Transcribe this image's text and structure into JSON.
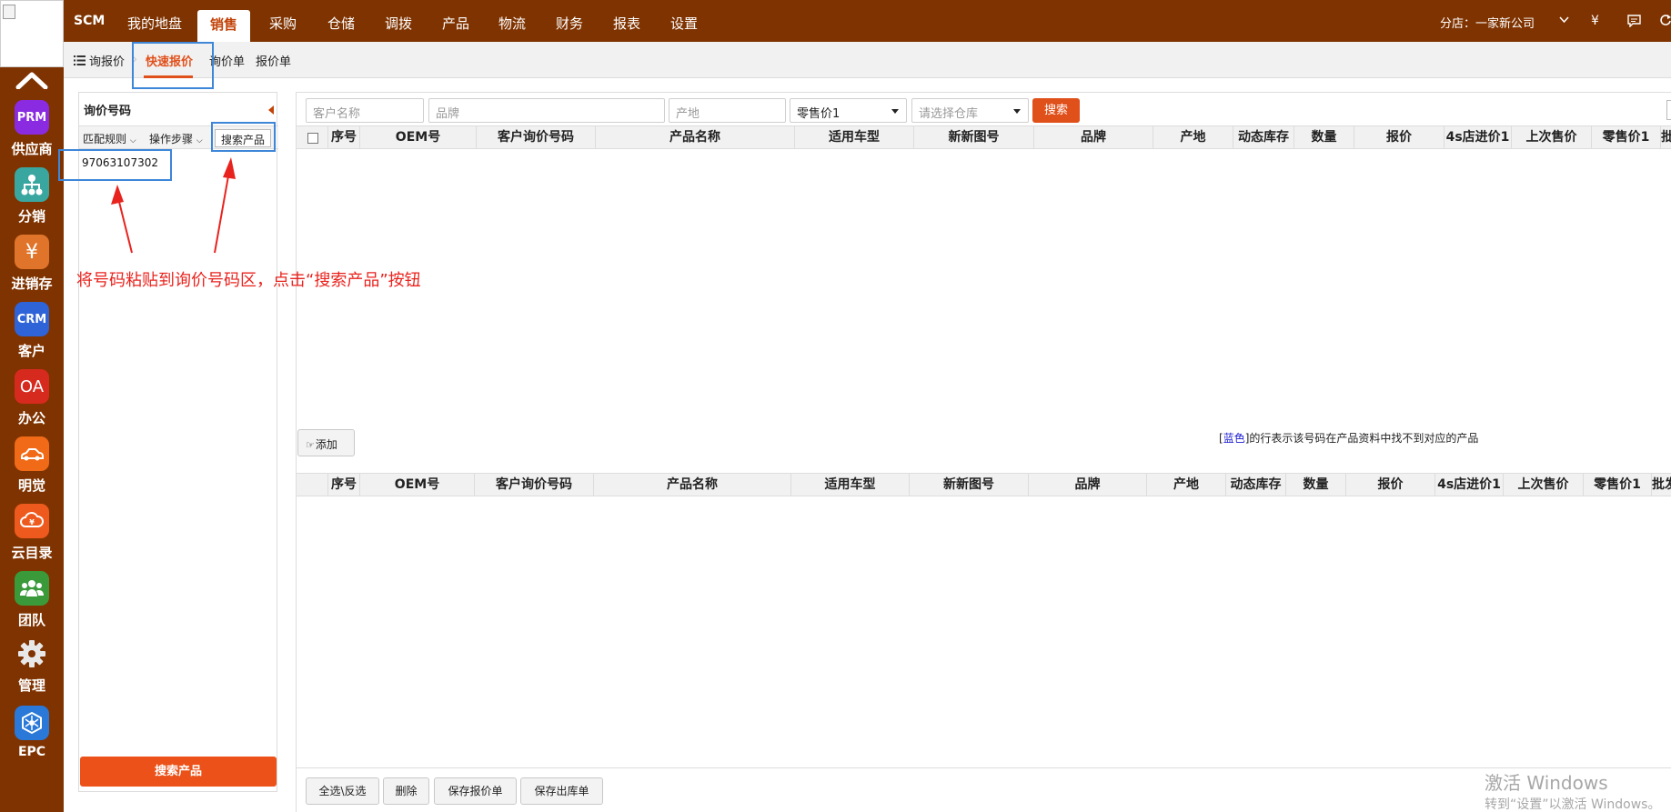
{
  "sidebar": {
    "apps": [
      {
        "label": "供应商",
        "icon_text": "PRM",
        "icon": "prm-icon",
        "color": "#8a2be2"
      },
      {
        "label": "分销",
        "icon_text": "",
        "icon": "distribution-tree-icon",
        "color": "#3aa6a0"
      },
      {
        "label": "进销存",
        "icon_text": "¥",
        "icon": "yuan-icon",
        "color": "#e0742a"
      },
      {
        "label": "客户",
        "icon_text": "CRM",
        "icon": "crm-icon",
        "color": "#2f63d8"
      },
      {
        "label": "办公",
        "icon_text": "OA",
        "icon": "oa-icon",
        "color": "#d62a1f"
      },
      {
        "label": "明觉",
        "icon_text": "",
        "icon": "car-icon",
        "color": "#f06a17"
      },
      {
        "label": "云目录",
        "icon_text": "",
        "icon": "cloud-catalog-icon",
        "color": "#ee5a1e"
      },
      {
        "label": "团队",
        "icon_text": "",
        "icon": "team-icon",
        "color": "#3a9a3a"
      },
      {
        "label": "管理",
        "icon_text": "",
        "icon": "gear-icon",
        "color": "#7f3300"
      },
      {
        "label": "EPC",
        "icon_text": "",
        "icon": "epc-icon",
        "color": "#2a78d8"
      }
    ]
  },
  "topnav": {
    "brand": "SCM",
    "items": [
      "我的地盘",
      "销售",
      "采购",
      "仓储",
      "调拨",
      "产品",
      "物流",
      "财务",
      "报表",
      "设置"
    ],
    "active": "销售",
    "branch": "分店：一家新公司",
    "currency": "¥"
  },
  "subnav": {
    "list_icon": "list-icon",
    "items": [
      "询报价",
      "快速报价",
      "询价单",
      "报价单"
    ],
    "active": "快速报价"
  },
  "left_panel": {
    "title": "询价号码",
    "match_rule": "匹配规则",
    "steps": "操作步骤",
    "search_product": "搜索产品",
    "code": "97063107302",
    "search_button": "搜索产品"
  },
  "filters": {
    "customer_placeholder": "客户名称",
    "brand_placeholder": "品牌",
    "origin_placeholder": "产地",
    "price_type": "零售价1",
    "warehouse_placeholder": "请选择仓库",
    "search_button": "搜索"
  },
  "table_top": {
    "columns": [
      "序号",
      "OEM号",
      "客户询价号码",
      "产品名称",
      "适用车型",
      "新新图号",
      "品牌",
      "产地",
      "动态库存",
      "数量",
      "报价",
      "4s店进价1",
      "上次售价",
      "零售价1",
      "批"
    ]
  },
  "table_bottom": {
    "columns": [
      "序号",
      "OEM号",
      "客户询价号码",
      "产品名称",
      "适用车型",
      "新新图号",
      "品牌",
      "产地",
      "动态库存",
      "数量",
      "报价",
      "4s店进价1",
      "上次售价",
      "零售价1",
      "批发"
    ]
  },
  "middle": {
    "add_button": "添加",
    "legend_bracket_open": "[",
    "legend_color": "蓝色",
    "legend_bracket_close": "]",
    "legend_text": "的行表示该号码在产品资料中找不到对应的产品"
  },
  "footer": {
    "buttons": [
      "全选\\反选",
      "删除",
      "保存报价单",
      "保存出库单"
    ]
  },
  "annotation": {
    "text": "将号码粘贴到询价号码区，点击“搜索产品”按钮",
    "color": "#e8231e"
  },
  "watermark": {
    "title": "激活 Windows",
    "subtitle": "转到“设置”以激活 Windows。"
  },
  "colors": {
    "brand_bg": "#7f3300",
    "accent": "#e0501b",
    "annotation_box": "#3d86d8"
  }
}
